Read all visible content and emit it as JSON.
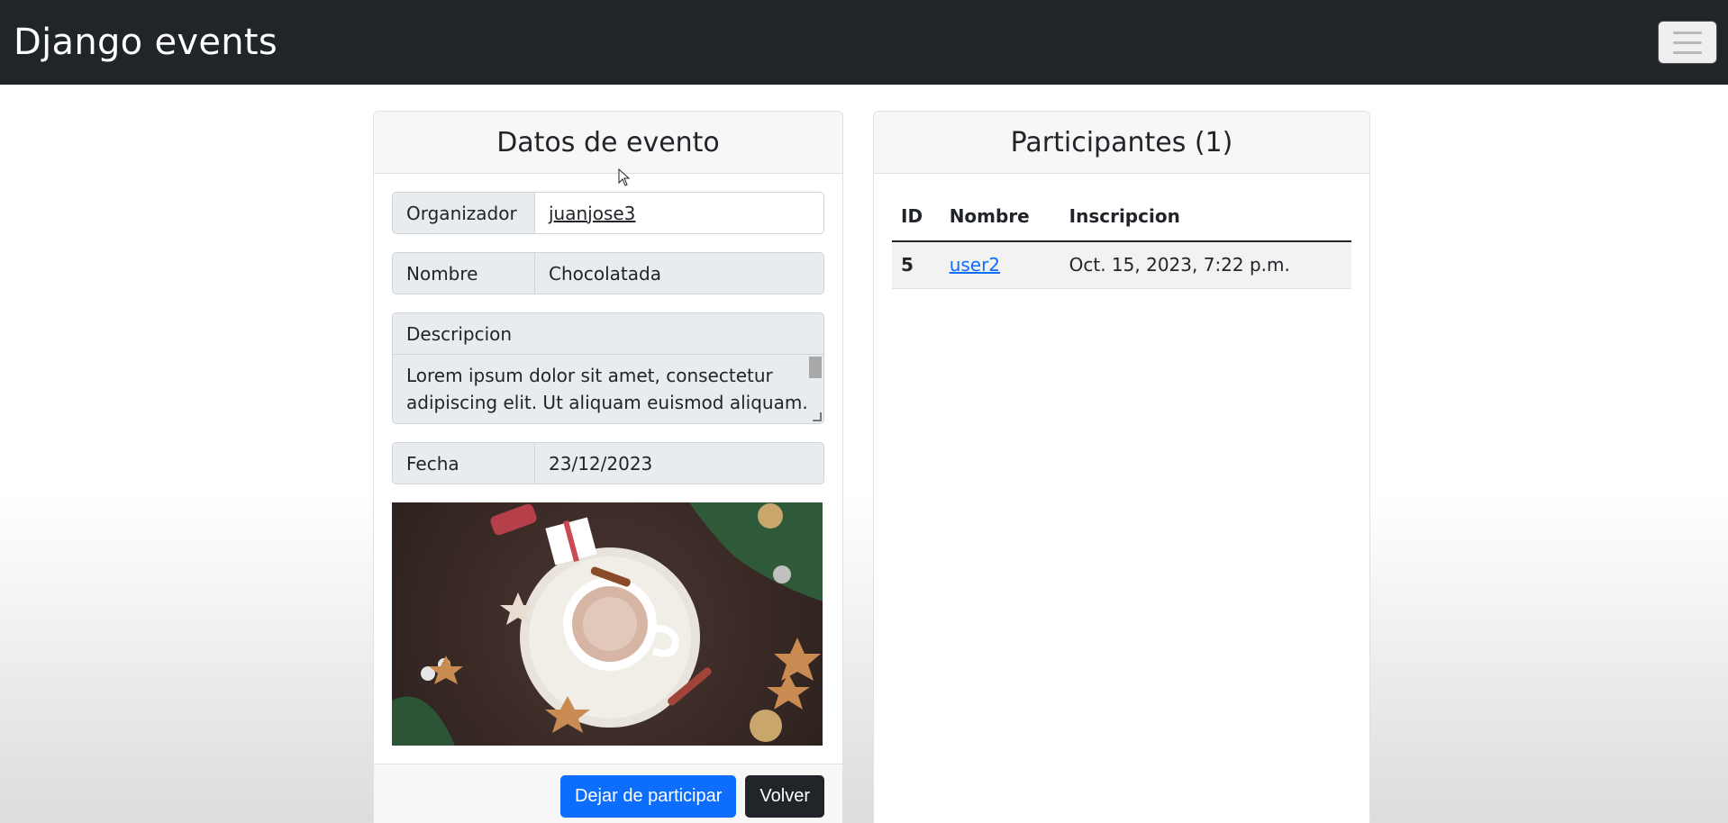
{
  "navbar": {
    "brand": "Django events",
    "toggler_icon": "hamburger-icon"
  },
  "event_card": {
    "title": "Datos de evento",
    "fields": {
      "organizador_label": "Organizador",
      "organizador_value": "juanjose3",
      "nombre_label": "Nombre",
      "nombre_value": "Chocolatada",
      "descripcion_label": "Descripcion",
      "descripcion_value": "Lorem ipsum dolor sit amet, consectetur adipiscing elit. Ut aliquam euismod aliquam.",
      "fecha_label": "Fecha",
      "fecha_value": "23/12/2023"
    },
    "buttons": {
      "leave": "Dejar de participar",
      "back": "Volver"
    }
  },
  "participants_card": {
    "title": "Participantes (1)",
    "columns": [
      "ID",
      "Nombre",
      "Inscripcion"
    ],
    "rows": [
      {
        "id": "5",
        "nombre": "user2",
        "inscripcion": "Oct. 15, 2023, 7:22 p.m."
      }
    ]
  },
  "colors": {
    "navbar": "#212529",
    "primary": "#0d6efd",
    "dark": "#212529"
  }
}
